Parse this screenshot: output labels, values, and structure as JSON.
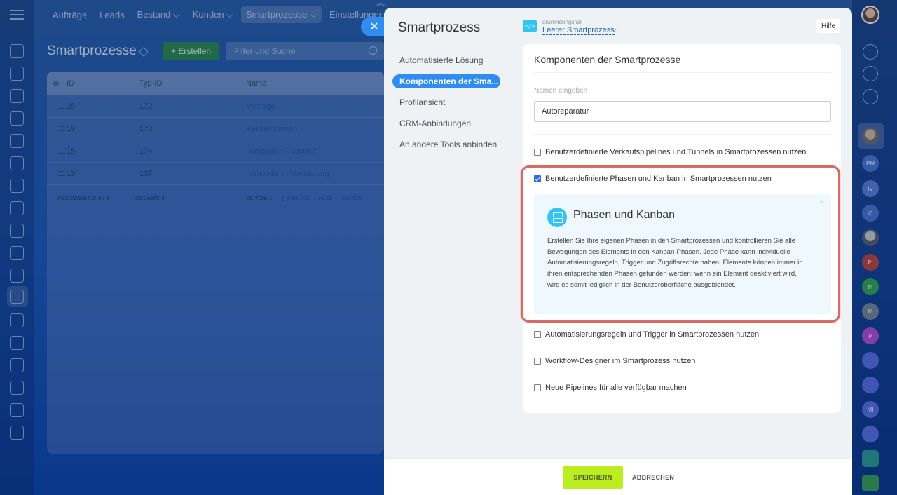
{
  "topnav": {
    "items": [
      "Aufträge",
      "Leads",
      "Bestand ⌵",
      "Kunden ⌵",
      "Smartprozesse ⌵",
      "Einstellungen ⌵"
    ],
    "new_badge": "NEU"
  },
  "page": {
    "title": "Smartprozesse",
    "create_label": "+ Erstellen",
    "filter_placeholder": "Filter und Suche"
  },
  "grid": {
    "headers": {
      "id": "ID",
      "type": "Typ-ID",
      "name": "Name"
    },
    "rows": [
      {
        "id": "25",
        "type": "172",
        "name": "Verträge"
      },
      {
        "id": "19",
        "type": "178",
        "name": "Reklamationen"
      },
      {
        "id": "15",
        "type": "174",
        "name": "Immobilien - Verkauf"
      },
      {
        "id": "13",
        "type": "137",
        "name": "Immobilien - Vermietung"
      }
    ],
    "footer": {
      "selected": "AUSGEWÄHLT: 0 / 4",
      "total": "GESAMT: 4",
      "pages": "SEITEN:  1",
      "back": "❮ ZURÜCK",
      "all": "ALLE",
      "next": "WEITER"
    }
  },
  "panel": {
    "title": "Smartprozess",
    "usecase_label": "anwendungsfall",
    "usecase_value": "Leerer Smartprozess",
    "usecase_icon": "</>",
    "help": "Hilfe",
    "menu": [
      "Automatisierte Lösung",
      "Komponenten der Sma...",
      "Profilansicht",
      "CRM-Anbindungen",
      "An andere Tools anbinden"
    ],
    "card_title": "Komponenten der Smartprozesse",
    "name_label": "Namen eingeben",
    "name_value": "Autoreparatur",
    "options": [
      {
        "label": "Benutzerdefinierte Verkaufspipelines und Tunnels in Smartprozessen nutzen",
        "checked": false
      },
      {
        "label": "Benutzerdefinierte Phasen und Kanban in Smartprozessen nutzen",
        "checked": true
      },
      {
        "label": "Automatisierungsregeln und Trigger in Smartprozessen nutzen",
        "checked": false
      },
      {
        "label": "Workflow-Designer im Smartprozess nutzen",
        "checked": false
      },
      {
        "label": "Neue Pipelines für alle verfügbar machen",
        "checked": false
      }
    ],
    "info": {
      "title": "Phasen und Kanban",
      "text": "Erstellen Sie Ihre eigenen Phasen in den Smartprozessen und kontrollieren Sie alle Bewegungen des Elements in den Kanban-Phasen. Jede Phase kann individuelle Automatisierungsregeln, Trigger und Zugriffsrechte haben. Elemente können immer in ihren entsprechenden Phasen gefunden werden; wenn ein Element deaktiviert wird, wird es somit lediglich in der Benutzeroberfläche ausgeblendet.",
      "close": "×"
    },
    "save": "SPEICHERN",
    "cancel": "ABBRECHEN"
  },
  "right_rail": {
    "avatars": [
      {
        "initials": "PM",
        "color": "#4b78d0"
      },
      {
        "initials": "IV",
        "color": "#5b7fd6"
      },
      {
        "initials": "C",
        "color": "#4d73d2"
      },
      {
        "initials": "PI",
        "color": "#c0443f"
      },
      {
        "initials": "M",
        "color": "#34a853"
      },
      {
        "initials": "M",
        "color": "#7c8793"
      },
      {
        "initials": "P",
        "color": "#b94ed0"
      },
      {
        "initials": "MI",
        "color": "#5a6fe0"
      }
    ]
  },
  "colors": {
    "accent": "#2f8cf0",
    "save": "#bbed21",
    "highlight": "#d96a63",
    "info_icon": "#2fc6f6"
  }
}
